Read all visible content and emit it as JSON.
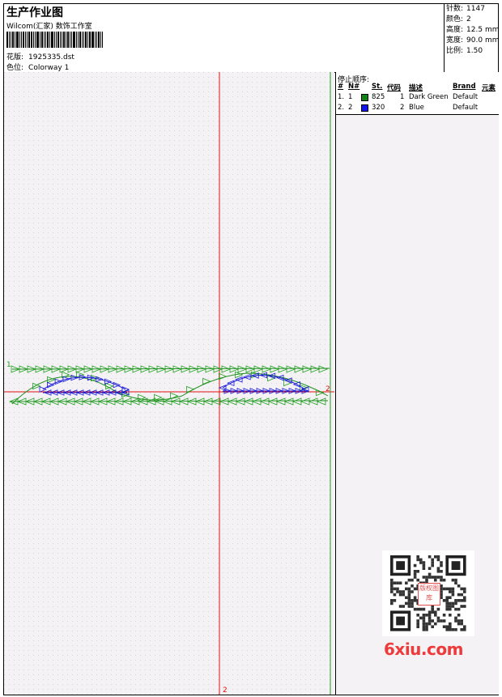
{
  "header": {
    "title": "生产作业图",
    "studio": "Wilcom(汇家) 数饰工作室",
    "design_label": "花版:",
    "design_file": "1925335.dst",
    "colorway_label": "色位:",
    "colorway": "Colorway 1"
  },
  "stats": [
    {
      "label": "针数:",
      "value": "1147"
    },
    {
      "label": "颜色:",
      "value": "2"
    },
    {
      "label": "高度:",
      "value": "12.5 mm"
    },
    {
      "label": "宽度:",
      "value": "90.0 mm"
    },
    {
      "label": "比例:",
      "value": "1.50"
    }
  ],
  "stop_sequence": {
    "title": "停止顺序:",
    "headers": [
      "#",
      "N#",
      "St.",
      "代码",
      "描述",
      "Brand",
      "元素"
    ],
    "rows": [
      {
        "idx": "1.",
        "n": "1",
        "code": "825",
        "code_no": "1",
        "desc": "Dark Green",
        "brand": "Default",
        "color": "#128212"
      },
      {
        "idx": "2.",
        "n": "2",
        "code": "320",
        "code_no": "2",
        "desc": "Blue",
        "brand": "Default",
        "color": "#1414ee"
      }
    ]
  },
  "canvas": {
    "marker_start": "1",
    "marker_right": "2",
    "marker_bottom": "2",
    "green_color": "#22a022",
    "blue_color": "#1a1ad8",
    "red_color": "#e01010"
  },
  "watermark": {
    "text": "6xiu.com",
    "qr_stamp": "版权图库"
  }
}
